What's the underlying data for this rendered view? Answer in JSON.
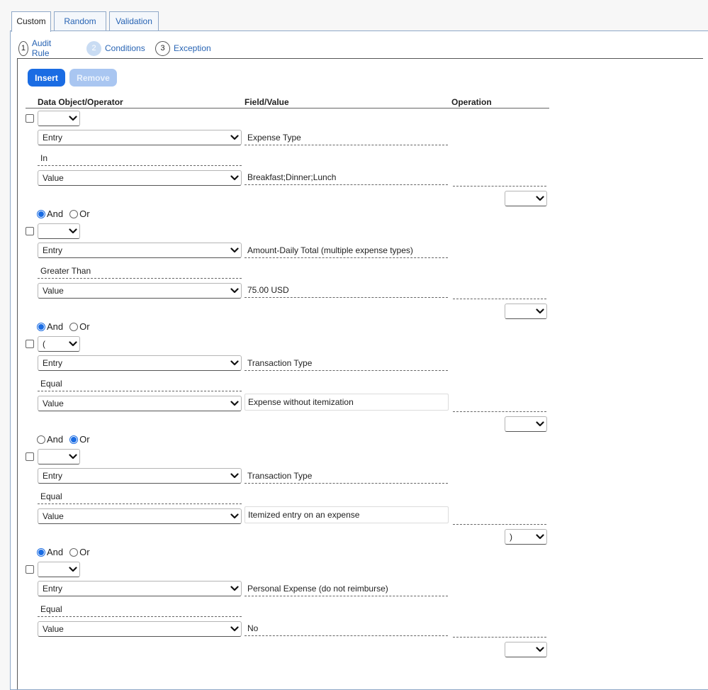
{
  "tabs": [
    "Custom",
    "Random",
    "Validation"
  ],
  "steps": [
    {
      "num": "1",
      "label": "Audit Rule"
    },
    {
      "num": "2",
      "label": "Conditions"
    },
    {
      "num": "3",
      "label": "Exception"
    }
  ],
  "buttons": {
    "insert": "Insert",
    "remove": "Remove"
  },
  "columns": {
    "data_object": "Data Object/Operator",
    "field_value": "Field/Value",
    "operation": "Operation"
  },
  "radio_labels": {
    "and": "And",
    "or": "Or"
  },
  "conditions": [
    {
      "open_paren": "",
      "left_type": "Entry",
      "field": "Expense Type",
      "operator": "In",
      "right_type": "Value",
      "value": "Breakfast;Dinner;Lunch",
      "value_boxed": false,
      "close_paren": "",
      "connector": "And"
    },
    {
      "open_paren": "",
      "left_type": "Entry",
      "field": "Amount-Daily Total (multiple expense types)",
      "operator": "Greater Than",
      "right_type": "Value",
      "value": "75.00 USD",
      "value_boxed": false,
      "close_paren": "",
      "connector": "And"
    },
    {
      "open_paren": "(",
      "left_type": "Entry",
      "field": "Transaction Type",
      "operator": "Equal",
      "right_type": "Value",
      "value": "Expense without itemization",
      "value_boxed": true,
      "close_paren": "",
      "connector": "Or"
    },
    {
      "open_paren": "",
      "left_type": "Entry",
      "field": "Transaction Type",
      "operator": "Equal",
      "right_type": "Value",
      "value": "Itemized entry on an expense",
      "value_boxed": true,
      "close_paren": ")",
      "connector": "And"
    },
    {
      "open_paren": "",
      "left_type": "Entry",
      "field": "Personal Expense  (do not reimburse)",
      "operator": "Equal",
      "right_type": "Value",
      "value": "No",
      "value_boxed": false,
      "close_paren": "",
      "connector": null
    }
  ],
  "colors": {
    "accent": "#1a6ce3",
    "accent_disabled": "#a9c6f1",
    "link": "#2864b4",
    "tab_border": "#8fa8c8"
  }
}
